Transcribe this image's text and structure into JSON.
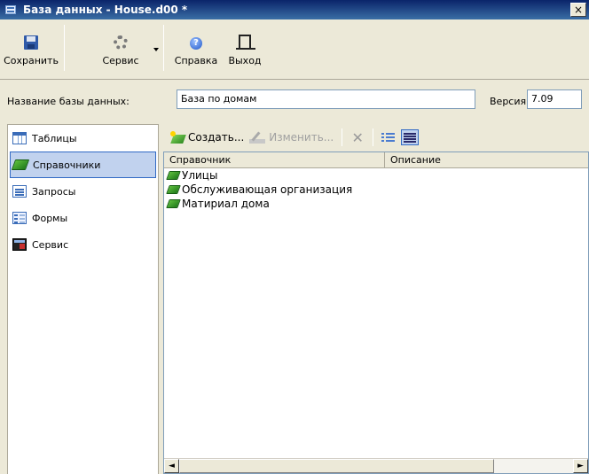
{
  "window": {
    "title": "База данных - House.d00 *",
    "close_glyph": "×"
  },
  "toolbar": {
    "items": [
      {
        "label": "Сохранить",
        "icon": "floppy-disk-icon"
      },
      {
        "label": "Сервис",
        "icon": "gear-icon"
      },
      {
        "label": "Справка",
        "icon": "help-icon"
      },
      {
        "label": "Выход",
        "icon": "exit-door-icon"
      }
    ]
  },
  "db_info": {
    "name_label": "Название базы данных:",
    "name_value": "База по домам",
    "version_label": "Версия:",
    "version_value": "7.09"
  },
  "sidebar": {
    "items": [
      {
        "label": "Таблицы",
        "icon": "table-icon",
        "selected": false
      },
      {
        "label": "Справочники",
        "icon": "book-icon",
        "selected": true
      },
      {
        "label": "Запросы",
        "icon": "query-icon",
        "selected": false
      },
      {
        "label": "Формы",
        "icon": "form-icon",
        "selected": false
      },
      {
        "label": "Сервис",
        "icon": "service-icon",
        "selected": false
      }
    ]
  },
  "pane_toolbar": {
    "create_label": "Создать...",
    "edit_label": "Изменить...",
    "delete_glyph": "✕"
  },
  "list": {
    "columns": [
      "Справочник",
      "Описание"
    ],
    "rows": [
      {
        "name": "Улицы",
        "description": ""
      },
      {
        "name": "Обслуживающая организация",
        "description": ""
      },
      {
        "name": "Матириал дома",
        "description": ""
      }
    ]
  },
  "scrollbar": {
    "left_glyph": "◄",
    "right_glyph": "►"
  },
  "colors": {
    "titlebar": "#0a246a",
    "selection": "#c1d2ee",
    "window_bg": "#ece9d8"
  }
}
